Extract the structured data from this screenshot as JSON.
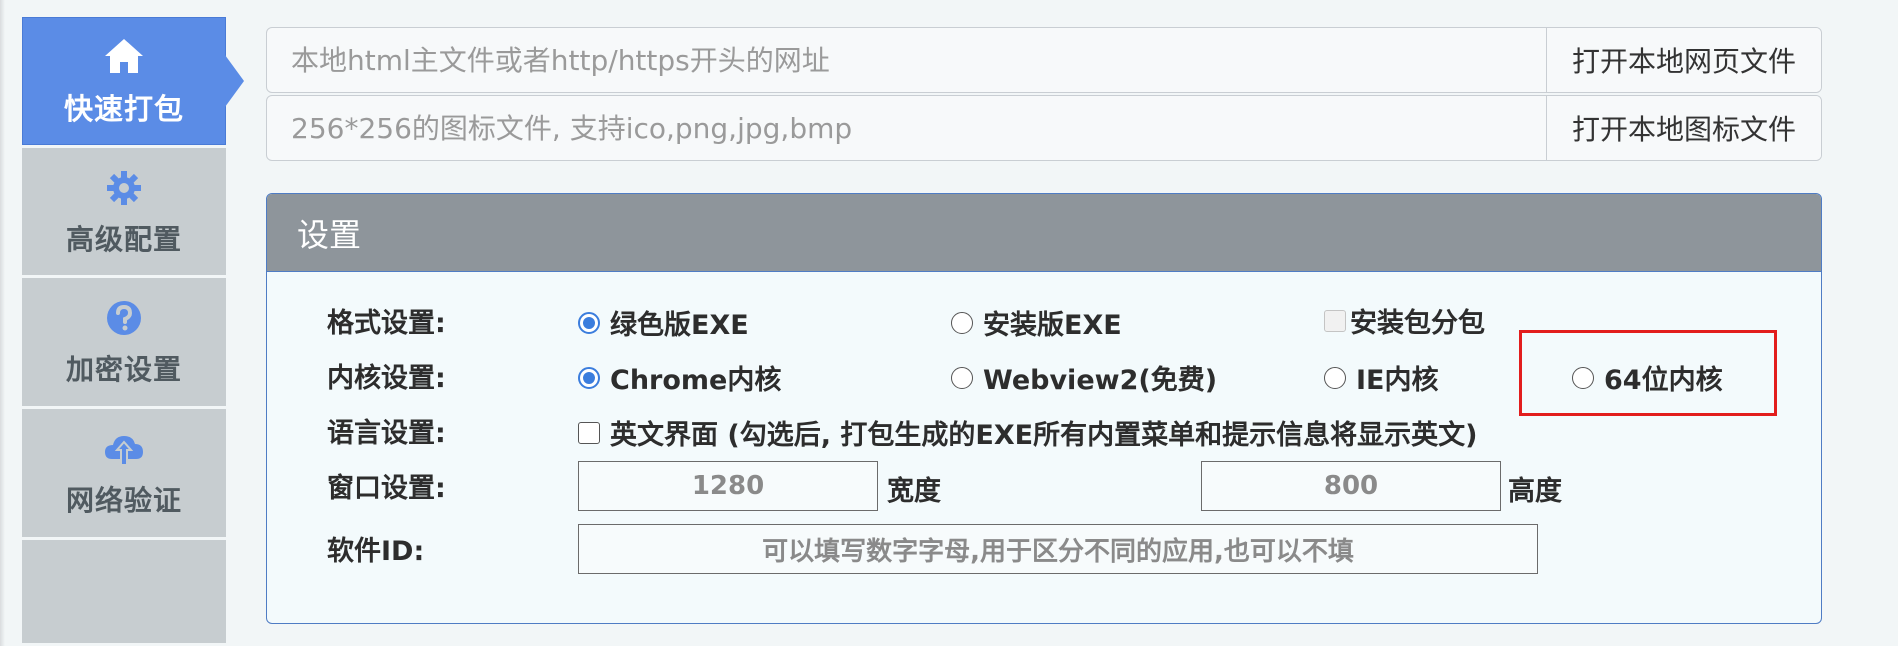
{
  "sidebar": {
    "items": [
      {
        "label": "快速打包",
        "icon": "home-icon"
      },
      {
        "label": "高级配置",
        "icon": "gear-icon"
      },
      {
        "label": "加密设置",
        "icon": "question-icon"
      },
      {
        "label": "网络验证",
        "icon": "cloud-upload-icon"
      }
    ]
  },
  "top": {
    "url_placeholder": "本地html主文件或者http/https开头的网址",
    "open_page_button": "打开本地网页文件",
    "icon_placeholder": "256*256的图标文件, 支持ico,png,jpg,bmp",
    "open_icon_button": "打开本地图标文件"
  },
  "settings": {
    "title": "设置",
    "format": {
      "label": "格式设置:",
      "options": [
        "绿色版EXE",
        "安装版EXE"
      ],
      "selected": "绿色版EXE",
      "split_package": "安装包分包"
    },
    "kernel": {
      "label": "内核设置:",
      "options": [
        "Chrome内核",
        "Webview2(免费)",
        "IE内核",
        "64位内核"
      ],
      "selected": "Chrome内核"
    },
    "language": {
      "label": "语言设置:",
      "english_ui": "英文界面 (勾选后, 打包生成的EXE所有内置菜单和提示信息将显示英文)"
    },
    "window": {
      "label": "窗口设置:",
      "width": "1280",
      "width_unit": "宽度",
      "height": "800",
      "height_unit": "高度"
    },
    "software_id": {
      "label": "软件ID:",
      "placeholder": "可以填写数字字母,用于区分不同的应用,也可以不填"
    }
  },
  "colors": {
    "active_nav": "#5b8ce6",
    "panel_border": "#4f7cc4",
    "panel_header": "#8e959b",
    "radio_accent": "#3b7ddd",
    "highlight": "#e21d1d"
  }
}
